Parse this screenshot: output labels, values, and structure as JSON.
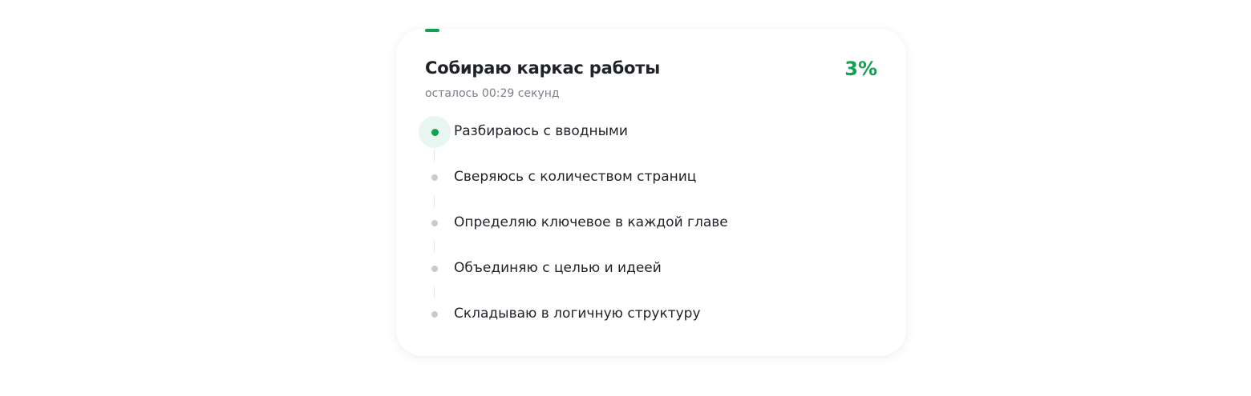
{
  "task": {
    "title": "Собираю каркас работы",
    "percent": "3%",
    "progress_fraction": 0.03,
    "subtitle": "осталось 00:29 секунд"
  },
  "steps": [
    {
      "label": "Разбираюсь с вводными",
      "state": "active"
    },
    {
      "label": "Сверяюсь с количеством страниц",
      "state": "pending"
    },
    {
      "label": "Определяю ключевое в каждой главе",
      "state": "pending"
    },
    {
      "label": "Объединяю с целью и идеей",
      "state": "pending"
    },
    {
      "label": "Складываю в логичную структуру",
      "state": "pending"
    }
  ],
  "colors": {
    "accent": "#12a150",
    "active_halo": "#e7f6ee",
    "pending_dot": "#c7cbd1",
    "text": "#1f2328",
    "muted": "#7b8088"
  }
}
